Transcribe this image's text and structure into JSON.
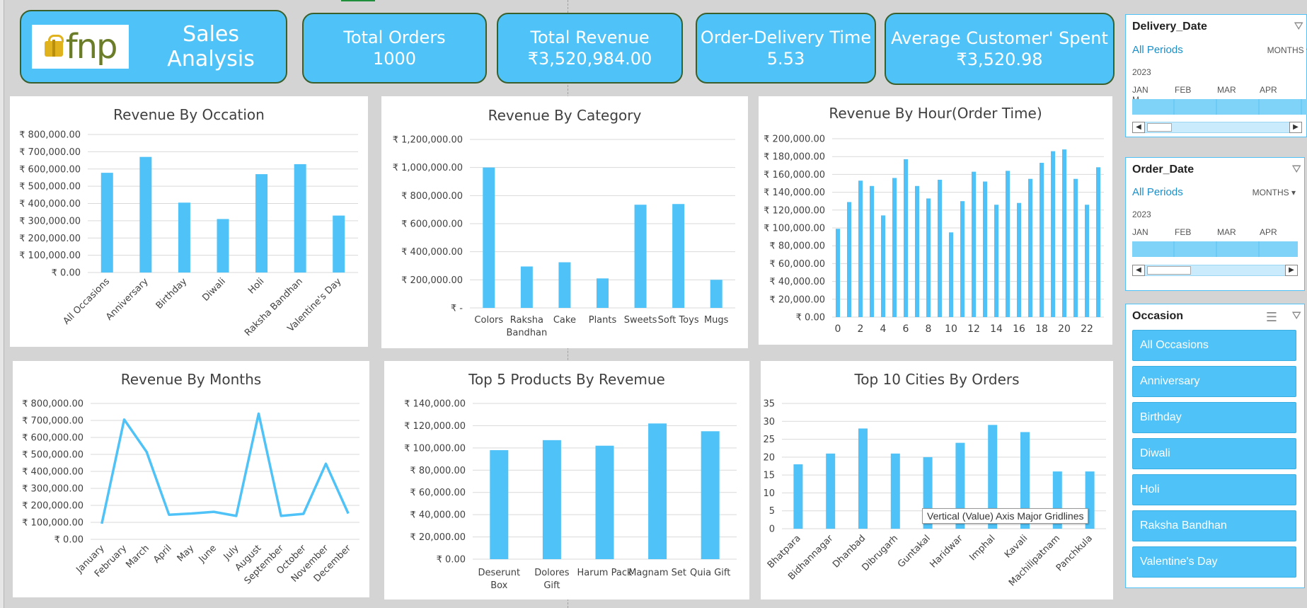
{
  "header": {
    "title": "Sales Analysis",
    "logo_text": "fnp"
  },
  "kpis": [
    {
      "title": "Total Orders",
      "value": "1000"
    },
    {
      "title": "Total Revenue",
      "value": "₹3,520,984.00"
    },
    {
      "title": "Order-Delivery Time",
      "value": "5.53"
    },
    {
      "title": "Average Customer' Spent",
      "value": "₹3,520.98"
    }
  ],
  "colors": {
    "bar": "#4fc3f7",
    "kpi": "#4fc3f7",
    "kpi_border": "#3b5f2b"
  },
  "chart_data": [
    {
      "type": "bar",
      "title": "Revenue By Occation",
      "categories": [
        "All Occasions",
        "Anniversary",
        "Birthday",
        "Diwali",
        "Holi",
        "Raksha Bandhan",
        "Valentine's Day"
      ],
      "values": [
        578000,
        670000,
        405000,
        310000,
        570000,
        628000,
        330000
      ],
      "ylim": [
        0,
        800000
      ],
      "yticks": [
        "₹ 0.00",
        "₹ 100,000.00",
        "₹ 200,000.00",
        "₹ 300,000.00",
        "₹ 400,000.00",
        "₹ 500,000.00",
        "₹ 600,000.00",
        "₹ 700,000.00",
        "₹ 800,000.00"
      ],
      "grid": true
    },
    {
      "type": "bar",
      "title": "Revenue By Category",
      "categories": [
        "Colors",
        "Raksha Bandhan",
        "Cake",
        "Plants",
        "Sweets",
        "Soft Toys",
        "Mugs"
      ],
      "values": [
        1000000,
        295000,
        325000,
        210000,
        735000,
        740000,
        200000
      ],
      "ylim": [
        0,
        1200000
      ],
      "yticks": [
        "₹ -",
        "₹ 200,000.00",
        "₹ 400,000.00",
        "₹ 600,000.00",
        "₹ 800,000.00",
        "₹ 1,000,000.00",
        "₹ 1,200,000.00"
      ],
      "grid": true
    },
    {
      "type": "bar",
      "title": "Revenue By Hour(Order Time)",
      "x": [
        0,
        1,
        2,
        3,
        4,
        5,
        6,
        7,
        8,
        9,
        10,
        11,
        12,
        13,
        14,
        15,
        16,
        17,
        18,
        19,
        20,
        21,
        22,
        23
      ],
      "xtick_labels": [
        "0",
        "2",
        "4",
        "6",
        "8",
        "10",
        "12",
        "14",
        "16",
        "18",
        "20",
        "22"
      ],
      "values": [
        99000,
        129000,
        153000,
        147000,
        114000,
        156000,
        177000,
        147000,
        133000,
        154000,
        95000,
        130000,
        163000,
        152000,
        126000,
        164000,
        128000,
        155000,
        173000,
        186000,
        188000,
        155000,
        126000,
        168000
      ],
      "ylim": [
        0,
        200000
      ],
      "yticks": [
        "₹ 0.00",
        "₹ 20,000.00",
        "₹ 40,000.00",
        "₹ 60,000.00",
        "₹ 80,000.00",
        "₹ 100,000.00",
        "₹ 120,000.00",
        "₹ 140,000.00",
        "₹ 160,000.00",
        "₹ 180,000.00",
        "₹ 200,000.00"
      ],
      "grid": true
    },
    {
      "type": "line",
      "title": "Revenue By Months",
      "categories": [
        "January",
        "February",
        "March",
        "April",
        "May",
        "June",
        "July",
        "August",
        "September",
        "October",
        "November",
        "December"
      ],
      "values": [
        92000,
        705000,
        515000,
        145000,
        152000,
        162000,
        138000,
        740000,
        138000,
        150000,
        445000,
        152000
      ],
      "ylim": [
        0,
        800000
      ],
      "yticks": [
        "₹ 0.00",
        "₹ 100,000.00",
        "₹ 200,000.00",
        "₹ 300,000.00",
        "₹ 400,000.00",
        "₹ 500,000.00",
        "₹ 600,000.00",
        "₹ 700,000.00",
        "₹ 800,000.00"
      ],
      "grid": true
    },
    {
      "type": "bar",
      "title": "Top 5 Products By Revemue",
      "categories": [
        "Deserunt Box",
        "Dolores Gift",
        "Harum Pack",
        "Magnam Set",
        "Quia Gift"
      ],
      "values": [
        98000,
        107000,
        102000,
        122000,
        115000
      ],
      "ylim": [
        0,
        140000
      ],
      "yticks": [
        "₹ 0.00",
        "₹ 20,000.00",
        "₹ 40,000.00",
        "₹ 60,000.00",
        "₹ 80,000.00",
        "₹ 100,000.00",
        "₹ 120,000.00",
        "₹ 140,000.00"
      ],
      "grid": true
    },
    {
      "type": "bar",
      "title": "Top 10 Cities By Orders",
      "categories": [
        "Bhatpara",
        "Bidhannagar",
        "Dhanbad",
        "Dibrugarh",
        "Guntakal",
        "Haridwar",
        "Imphal",
        "Kavali",
        "Machilipatnam",
        "Panchkula"
      ],
      "values": [
        18,
        21,
        28,
        21,
        20,
        24,
        29,
        27,
        16,
        16
      ],
      "ylim": [
        0,
        35
      ],
      "yticks": [
        "0",
        "5",
        "10",
        "15",
        "20",
        "25",
        "30",
        "35"
      ],
      "grid": true
    }
  ],
  "tooltip": "Vertical (Value) Axis Major Gridlines",
  "slicers": {
    "delivery": {
      "title": "Delivery_Date",
      "all": "All Periods",
      "level": "MONTHS",
      "year": "2023",
      "months": [
        "JAN",
        "FEB",
        "MAR",
        "APR",
        "M"
      ]
    },
    "order": {
      "title": "Order_Date",
      "all": "All Periods",
      "level": "MONTHS",
      "year": "2023",
      "months": [
        "JAN",
        "FEB",
        "MAR",
        "APR"
      ]
    },
    "occasion": {
      "title": "Occasion",
      "items": [
        "All Occasions",
        "Anniversary",
        "Birthday",
        "Diwali",
        "Holi",
        "Raksha Bandhan",
        "Valentine's Day"
      ]
    }
  }
}
